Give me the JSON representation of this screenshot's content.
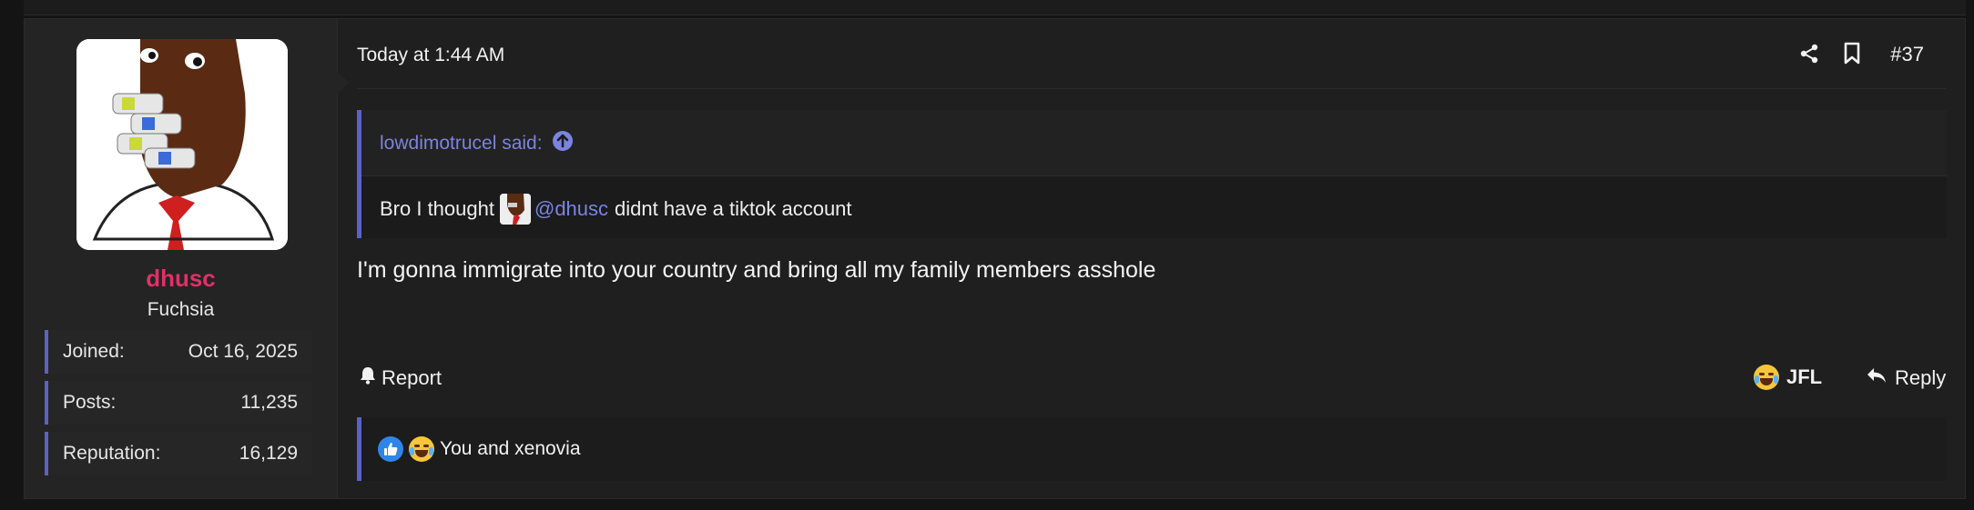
{
  "post": {
    "author": {
      "username": "dhusc",
      "title": "Fuchsia",
      "stats": [
        {
          "label": "Joined:",
          "value": "Oct 16, 2025"
        },
        {
          "label": "Posts:",
          "value": "11,235"
        },
        {
          "label": "Reputation:",
          "value": "16,129"
        }
      ]
    },
    "timestamp": "Today at 1:44 AM",
    "number": "#37",
    "quote": {
      "author_said": "lowdimotrucel said:",
      "text_before": "Bro I thought",
      "mention": "@dhusc",
      "text_after": "didnt have a tiktok account"
    },
    "message": "I'm gonna immigrate into your country and bring all my family members asshole",
    "actions": {
      "report": "Report",
      "reaction": "JFL",
      "reply": "Reply"
    },
    "reactions_summary": "You and xenovia"
  },
  "colors": {
    "accent": "#5a62c9",
    "username": "#e0306a",
    "link": "#7b84e0"
  },
  "icons": [
    "share-icon",
    "bookmark-icon",
    "arrow-up-circle-icon",
    "bell-icon",
    "laughing-emoji-icon",
    "reply-arrow-icon",
    "like-icon"
  ]
}
